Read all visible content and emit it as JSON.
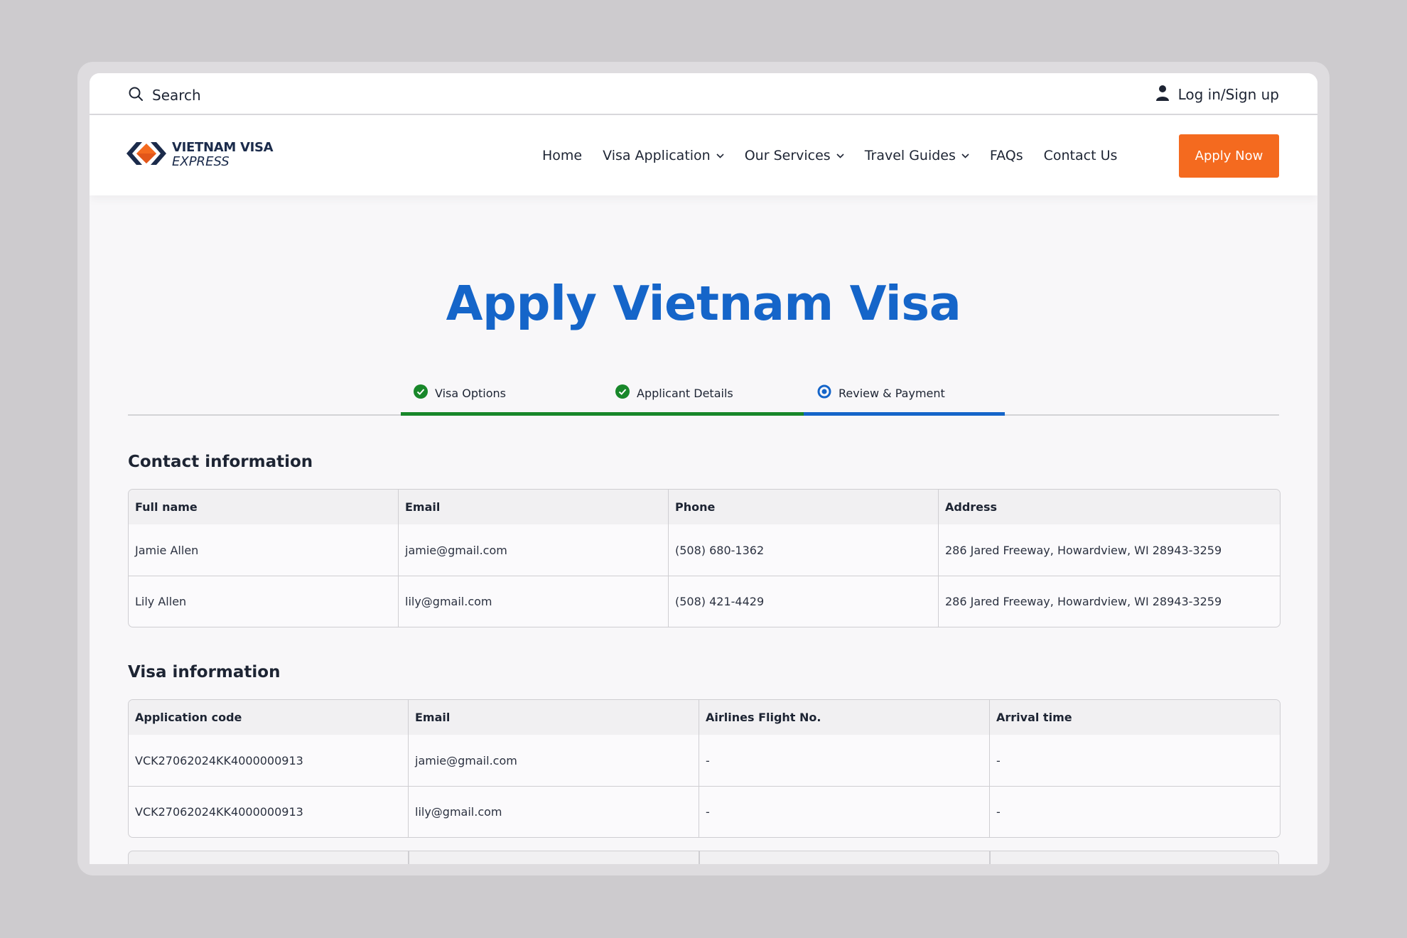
{
  "topbar": {
    "search_label": "Search",
    "login_label": "Log in/Sign up"
  },
  "logo": {
    "line1": "VIETNAM VISA",
    "line2": "EXPRESS",
    "colors": {
      "navy": "#1b2b4b",
      "orange": "#f46a1f"
    }
  },
  "nav": {
    "items": [
      {
        "label": "Home",
        "dropdown": false
      },
      {
        "label": "Visa Application",
        "dropdown": true
      },
      {
        "label": "Our Services",
        "dropdown": true
      },
      {
        "label": "Travel Guides",
        "dropdown": true
      },
      {
        "label": "FAQs",
        "dropdown": false
      },
      {
        "label": "Contact Us",
        "dropdown": false
      }
    ],
    "cta_label": "Apply Now"
  },
  "page": {
    "title": "Apply Vietnam Visa"
  },
  "stepper": {
    "steps": [
      {
        "label": "Visa Options",
        "status": "complete",
        "icon": "check-circle-icon"
      },
      {
        "label": "Applicant Details",
        "status": "complete",
        "icon": "check-circle-icon"
      },
      {
        "label": "Review & Payment",
        "status": "current",
        "icon": "radio-dot-icon"
      }
    ]
  },
  "contact": {
    "title": "Contact information",
    "headers": [
      "Full name",
      "Email",
      "Phone",
      "Address"
    ],
    "rows": [
      [
        "Jamie Allen",
        "jamie@gmail.com",
        "(508) 680-1362",
        "286 Jared Freeway, Howardview, WI 28943-3259"
      ],
      [
        "Lily Allen",
        "lily@gmail.com",
        "(508) 421-4429",
        "286 Jared Freeway, Howardview, WI 28943-3259"
      ]
    ]
  },
  "visa": {
    "title": "Visa information",
    "headers": [
      "Application code",
      "Email",
      "Airlines Flight No.",
      "Arrival time"
    ],
    "rows": [
      [
        "VCK27062024KK4000000913",
        "jamie@gmail.com",
        "-",
        "-"
      ],
      [
        "VCK27062024KK4000000913",
        "lily@gmail.com",
        "-",
        "-"
      ]
    ]
  },
  "colors": {
    "accent": "#1565c9",
    "cta": "#f46a1f",
    "complete": "#18872a"
  }
}
